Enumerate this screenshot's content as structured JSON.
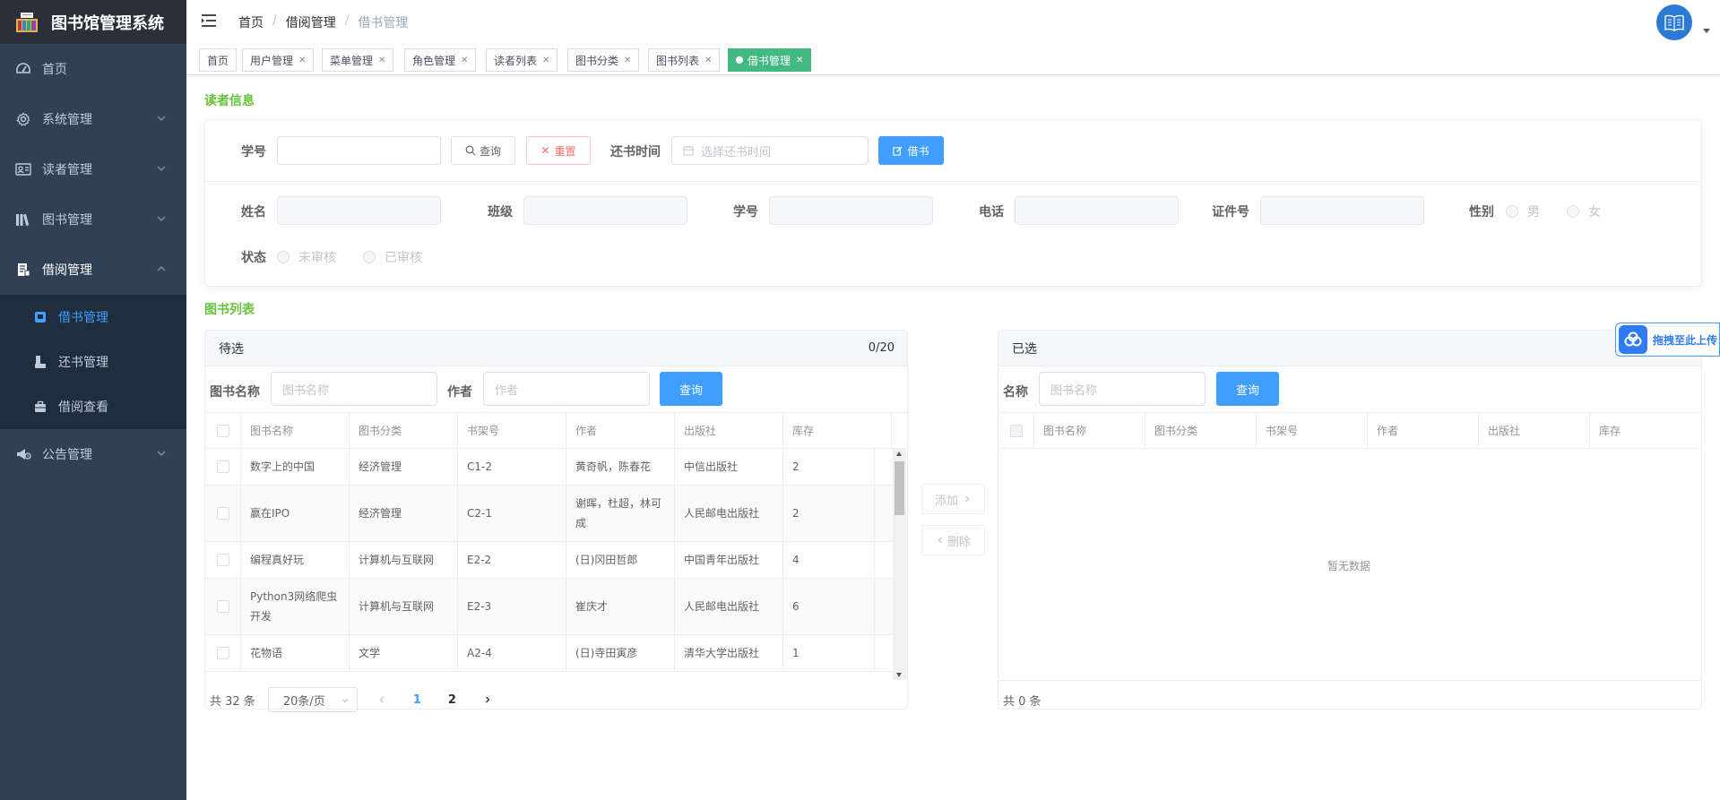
{
  "app": {
    "title": "图书馆管理系统"
  },
  "sidebar": {
    "items": [
      {
        "label": "首页",
        "icon": "dashboard-icon"
      },
      {
        "label": "系统管理",
        "icon": "gear-icon"
      },
      {
        "label": "读者管理",
        "icon": "id-card-icon"
      },
      {
        "label": "图书管理",
        "icon": "books-icon"
      },
      {
        "label": "借阅管理",
        "icon": "document-icon"
      },
      {
        "label": "公告管理",
        "icon": "announcement-icon"
      }
    ],
    "sub_items": [
      {
        "label": "借书管理",
        "icon": "book-icon"
      },
      {
        "label": "还书管理",
        "icon": "return-icon"
      },
      {
        "label": "借阅查看",
        "icon": "briefcase-icon"
      }
    ]
  },
  "breadcrumb": [
    "首页",
    "借阅管理",
    "借书管理"
  ],
  "tags": [
    "首页",
    "用户管理",
    "菜单管理",
    "角色管理",
    "读者列表",
    "图书分类",
    "图书列表",
    "借书管理"
  ],
  "reader": {
    "section_title": "读者信息",
    "student_id_label": "学号",
    "query_btn": "查询",
    "reset_btn": "重置",
    "return_time_label": "还书时间",
    "return_time_placeholder": "选择还书时间",
    "borrow_btn": "借书",
    "fields": {
      "name": "姓名",
      "class": "班级",
      "student_id": "学号",
      "phone": "电话",
      "id_number": "证件号",
      "gender": "性别",
      "gender_male": "男",
      "gender_female": "女",
      "status": "状态",
      "status_pending": "未审核",
      "status_approved": "已审核"
    }
  },
  "books": {
    "section_title": "图书列表",
    "left": {
      "title": "待选",
      "count": "0/20",
      "book_name_label": "图书名称",
      "book_name_placeholder": "图书名称",
      "author_label": "作者",
      "author_placeholder": "作者",
      "query_btn": "查询",
      "columns": [
        "图书名称",
        "图书分类",
        "书架号",
        "作者",
        "出版社",
        "库存"
      ],
      "rows": [
        [
          "数字上的中国",
          "经济管理",
          "C1-2",
          "黄奇帆，陈春花",
          "中信出版社",
          "2"
        ],
        [
          "赢在IPO",
          "经济管理",
          "C2-1",
          "谢晖，杜超，林可成",
          "人民邮电出版社",
          "2"
        ],
        [
          "编程真好玩",
          "计算机与互联网",
          "E2-2",
          "(日)冈田哲郎",
          "中国青年出版社",
          "4"
        ],
        [
          "Python3网络爬虫开发",
          "计算机与互联网",
          "E2-3",
          "崔庆才",
          "人民邮电出版社",
          "6"
        ],
        [
          "花物语",
          "文学",
          "A2-4",
          "(日)寺田寅彦",
          "清华大学出版社",
          "1"
        ]
      ],
      "total": "共 32 条",
      "page_size": "20条/页",
      "pages": [
        "1",
        "2"
      ]
    },
    "add_btn": "添加",
    "remove_btn": "删除",
    "right": {
      "title": "已选",
      "name_label": "名称",
      "name_placeholder": "图书名称",
      "query_btn": "查询",
      "columns": [
        "图书名称",
        "图书分类",
        "书架号",
        "作者",
        "出版社",
        "库存"
      ],
      "empty": "暂无数据",
      "total": "共 0 条"
    }
  },
  "float_upload": {
    "label": "拖拽至此上传"
  },
  "colors": {
    "sidebar": "#304156",
    "accent": "#409eff",
    "section": "#67c23a",
    "active_tag": "#42b983"
  }
}
